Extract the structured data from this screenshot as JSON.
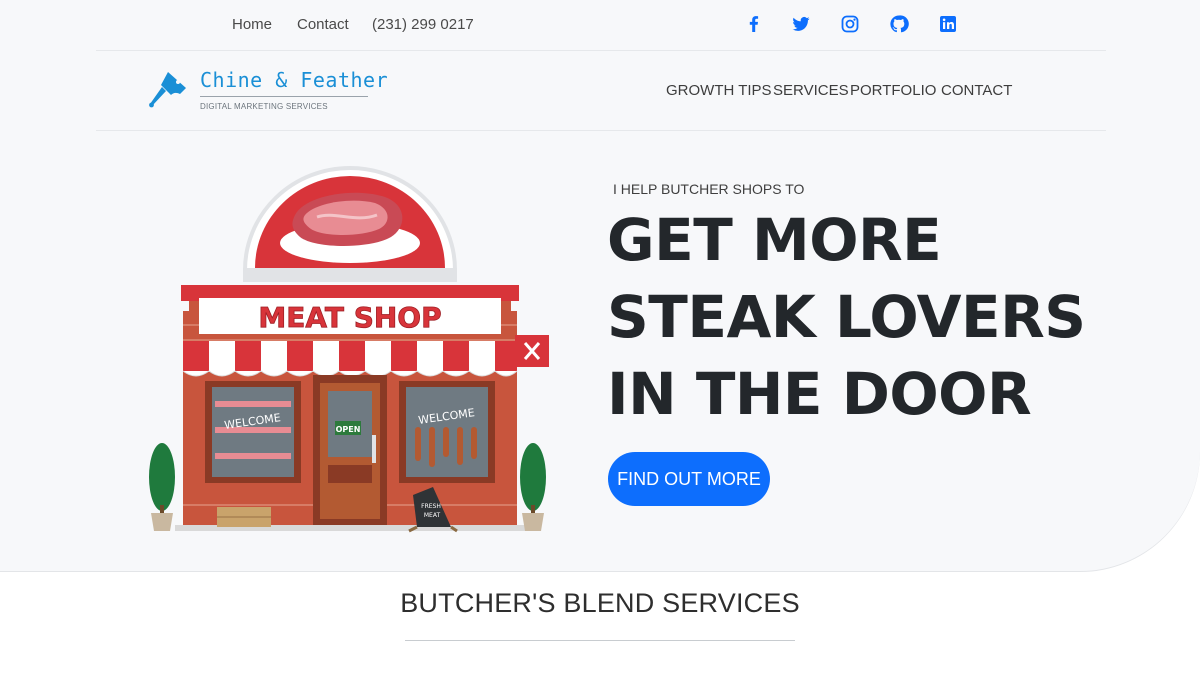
{
  "topbar": {
    "links": [
      "Home",
      "Contact",
      "(231) 299 0217"
    ],
    "social_icons": [
      "facebook-icon",
      "twitter-icon",
      "instagram-icon",
      "github-icon",
      "linkedin-icon"
    ]
  },
  "brand": {
    "name": "Chine & Feather",
    "tagline": "DIGITAL MARKETING SERVICES",
    "logo_icon": "cleaver-icon"
  },
  "nav": {
    "items": [
      "GROWTH TIPS",
      "SERVICES",
      "PORTFOLIO",
      "CONTACT"
    ]
  },
  "hero": {
    "kicker": "I HELP BUTCHER SHOPS TO",
    "headline": [
      "GET MORE",
      "STEAK LOVERS",
      "IN THE DOOR"
    ],
    "cta": "FIND OUT MORE",
    "illustration": {
      "shop_sign": "MEAT SHOP",
      "door_sign": "OPEN",
      "window_text": "WELCOME",
      "board_text": [
        "FRESH",
        "MEAT"
      ]
    }
  },
  "services": {
    "title": "BUTCHER'S BLEND SERVICES"
  },
  "colors": {
    "accent": "#0d6efd",
    "brand": "#1a8fd6",
    "hero_bg": "#f7f8fa",
    "shop_red": "#d8343a",
    "brick": "#c8553d"
  }
}
